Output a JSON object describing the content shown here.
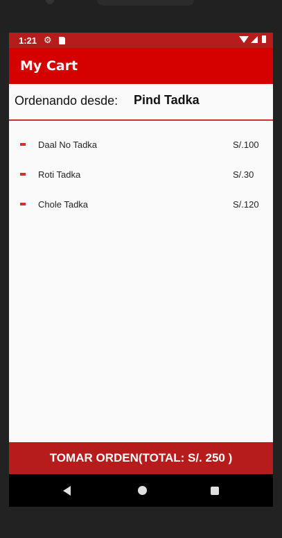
{
  "status_bar": {
    "time": "1:21",
    "icons": [
      "gear-icon",
      "sd-card-icon",
      "wifi-icon",
      "signal-icon",
      "battery-icon"
    ]
  },
  "app_bar": {
    "title": "My Cart"
  },
  "order_from": {
    "label": "Ordenando desde:",
    "restaurant": "Pind Tadka"
  },
  "cart": {
    "items": [
      {
        "name": "Daal No Tadka",
        "price": "S/.100"
      },
      {
        "name": "Roti Tadka",
        "price": "S/.30"
      },
      {
        "name": "Chole Tadka",
        "price": "S/.120"
      }
    ]
  },
  "order_button": {
    "label": "TOMAR ORDEN(TOTAL: S/. 250 )"
  },
  "nav_bar": {
    "icons": [
      "back-icon",
      "home-icon",
      "recent-apps-icon"
    ]
  },
  "colors": {
    "status_bar": "#b71c1c",
    "app_bar": "#d50000",
    "accent": "#d32f2f",
    "order_button": "#b71c1c"
  }
}
